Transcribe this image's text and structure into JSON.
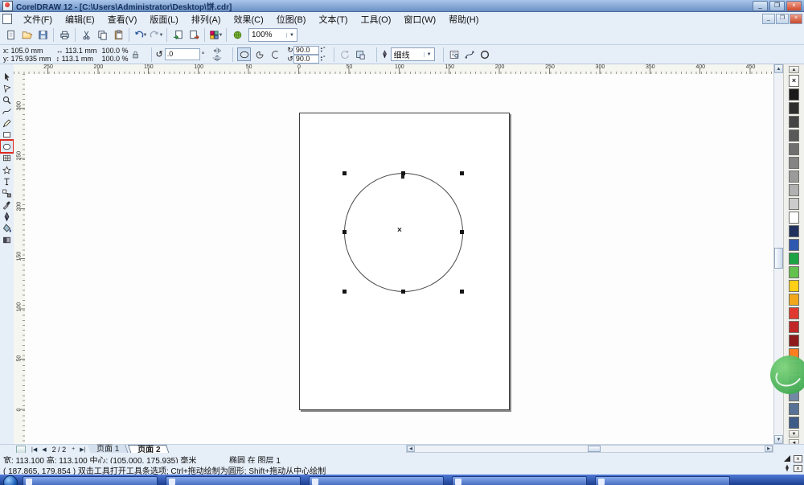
{
  "window": {
    "title": "CorelDRAW 12 - [C:\\Users\\Administrator\\Desktop\\饼.cdr]",
    "minimize_glyph": "_",
    "maximize_glyph": "❐",
    "close_glyph": "×"
  },
  "menus": [
    "文件(F)",
    "编辑(E)",
    "查看(V)",
    "版面(L)",
    "排列(A)",
    "效果(C)",
    "位图(B)",
    "文本(T)",
    "工具(O)",
    "窗口(W)",
    "帮助(H)"
  ],
  "std_toolbar": {
    "buttons": [
      "new",
      "open",
      "save",
      "|",
      "print",
      "|",
      "cut",
      "copy",
      "paste",
      "|",
      "undo",
      "redo",
      "|",
      "import",
      "export",
      "|",
      "launcher",
      "|",
      "online"
    ],
    "zoom_value": "100%"
  },
  "property_bar": {
    "x_label": "x:",
    "x_value": "105.0 mm",
    "y_label": "y:",
    "y_value": "175.935 mm",
    "w_value": "113.1 mm",
    "h_value": "113.1 mm",
    "scale_x": "100.0 %",
    "scale_y": "100.0 %",
    "rotation_value": ".0",
    "rotation_suffix": "°",
    "angle_start": "90.0",
    "angle_end": "90.0",
    "outline_width": "细线"
  },
  "toolbox": {
    "tools": [
      "pick-tool",
      "shape-tool",
      "zoom-tool",
      "freehand-tool",
      "smart-drawing-tool",
      "rectangle-tool",
      "ellipse-tool",
      "graph-paper-tool",
      "basic-shapes-tool",
      "text-tool",
      "interactive-blend-tool",
      "eyedropper-tool",
      "outline-tool",
      "fill-tool",
      "interactive-fill-tool"
    ],
    "active_tool": "ellipse-tool",
    "highlight_color": "#e02b20"
  },
  "rulers": {
    "h_labels": [
      "250",
      "200",
      "150",
      "100",
      "50",
      "0",
      "50",
      "100",
      "150",
      "200",
      "250",
      "300",
      "350",
      "400",
      "450"
    ],
    "v_labels": [
      "300",
      "250",
      "200",
      "150",
      "100",
      "50",
      "0"
    ]
  },
  "canvas": {
    "selection_center_glyph": "×"
  },
  "palette": {
    "no_color_glyph": "×",
    "colors": [
      "#1a1a1a",
      "#2e2e2e",
      "#444444",
      "#595959",
      "#6f6f6f",
      "#858585",
      "#9b9b9b",
      "#b1b1b1",
      "#cccccc",
      "#ffffff",
      "#20315e",
      "#2f58b0",
      "#1ca344",
      "#63c14e",
      "#ffd017",
      "#f2a71b",
      "#e03a2f",
      "#c22727",
      "#8e1c1c",
      "#ff7d1e",
      "#e59a8c",
      "#8ea0b4",
      "#7289a6",
      "#587297",
      "#3e5c88"
    ]
  },
  "nav": {
    "counter": "2 / 2",
    "tabs": [
      {
        "label": "页面 1",
        "active": false
      },
      {
        "label": "页面 2",
        "active": true
      }
    ]
  },
  "status": {
    "line1_left": "宽: 113.100  高: 113.100  中心: (105.000, 175.935) 毫米",
    "line1_right": "椭圆 在 图层 1",
    "line2": "( 187.865, 179.854 )    双击工具打开工具条选项; Ctrl+拖动绘制为圆形; Shift+拖动从中心绘制",
    "fill_none_glyph": "×",
    "outline_none_glyph": "×"
  },
  "taskbar": {
    "buttons": [
      "",
      "",
      "",
      "",
      ""
    ]
  }
}
